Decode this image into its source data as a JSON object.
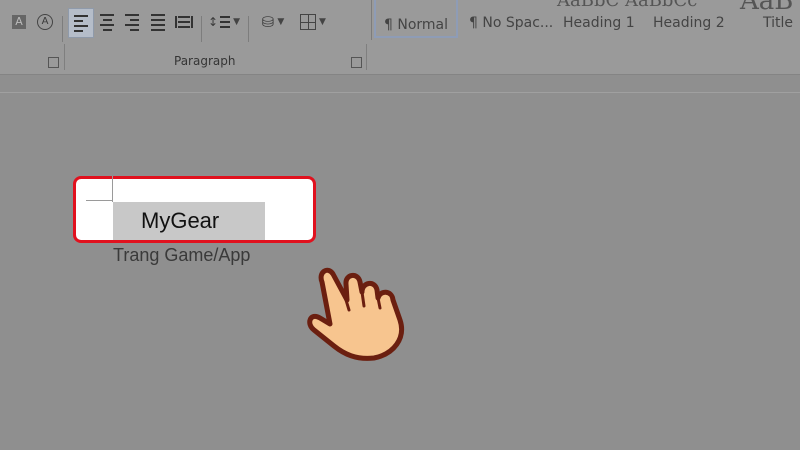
{
  "ribbon": {
    "paragraph_group_label": "Paragraph",
    "styles": [
      {
        "label": "¶ Normal",
        "selected": true
      },
      {
        "label": "¶ No Spac...",
        "selected": false
      },
      {
        "label": "Heading 1",
        "selected": false
      },
      {
        "label": "Heading 2",
        "selected": false
      },
      {
        "label": "Title",
        "selected": false
      }
    ],
    "icons": [
      "text-highlight-icon",
      "strikethrough-circle-icon",
      "align-left-icon",
      "align-center-icon",
      "align-right-icon",
      "justify-icon",
      "distributed-icon",
      "line-spacing-icon",
      "shading-icon",
      "borders-icon"
    ]
  },
  "document": {
    "cell_text": "MyGear",
    "caption": "Trang Game/App"
  },
  "colors": {
    "highlight_border": "#e1111e",
    "hand_fill": "#f7c58f",
    "hand_outline": "#6b1f10"
  }
}
